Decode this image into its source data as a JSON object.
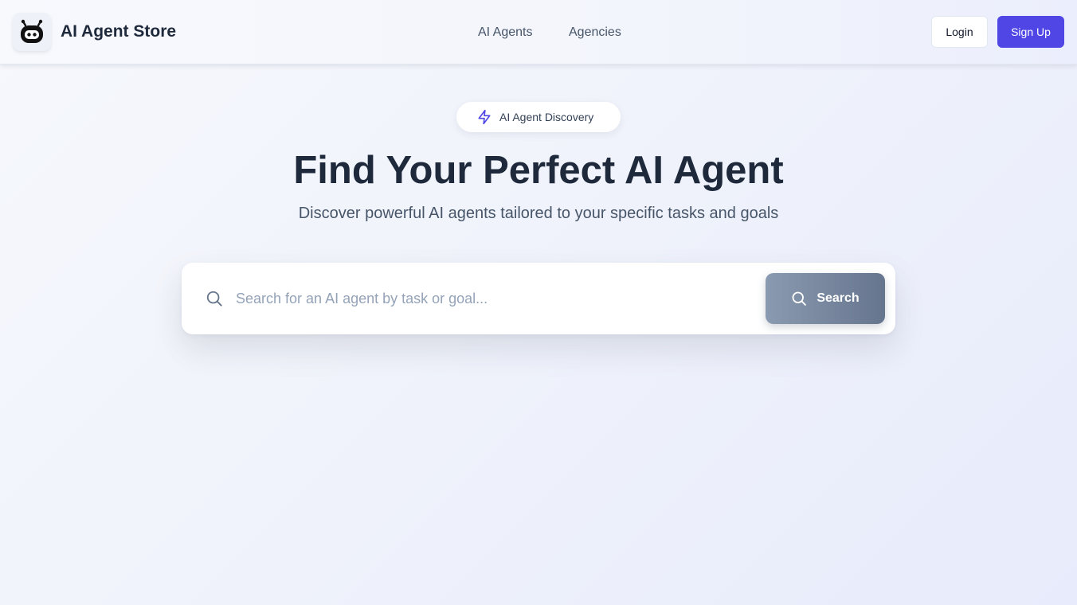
{
  "header": {
    "brand": "AI Agent Store",
    "logo_icon": "robot-icon",
    "nav": [
      {
        "label": "AI Agents"
      },
      {
        "label": "Agencies"
      }
    ],
    "login_label": "Login",
    "signup_label": "Sign Up"
  },
  "hero": {
    "badge_icon": "lightning-icon",
    "badge_label": "AI Agent Discovery",
    "title": "Find Your Perfect AI Agent",
    "subtitle": "Discover powerful AI agents tailored to your specific tasks and goals"
  },
  "search": {
    "placeholder": "Search for an AI agent by task or goal...",
    "value": "",
    "button_label": "Search",
    "icon": "search-icon"
  },
  "colors": {
    "accent": "#4f46e5",
    "title": "#1e293b",
    "search_button_start": "#8a9ab0",
    "search_button_end": "#66758e"
  }
}
